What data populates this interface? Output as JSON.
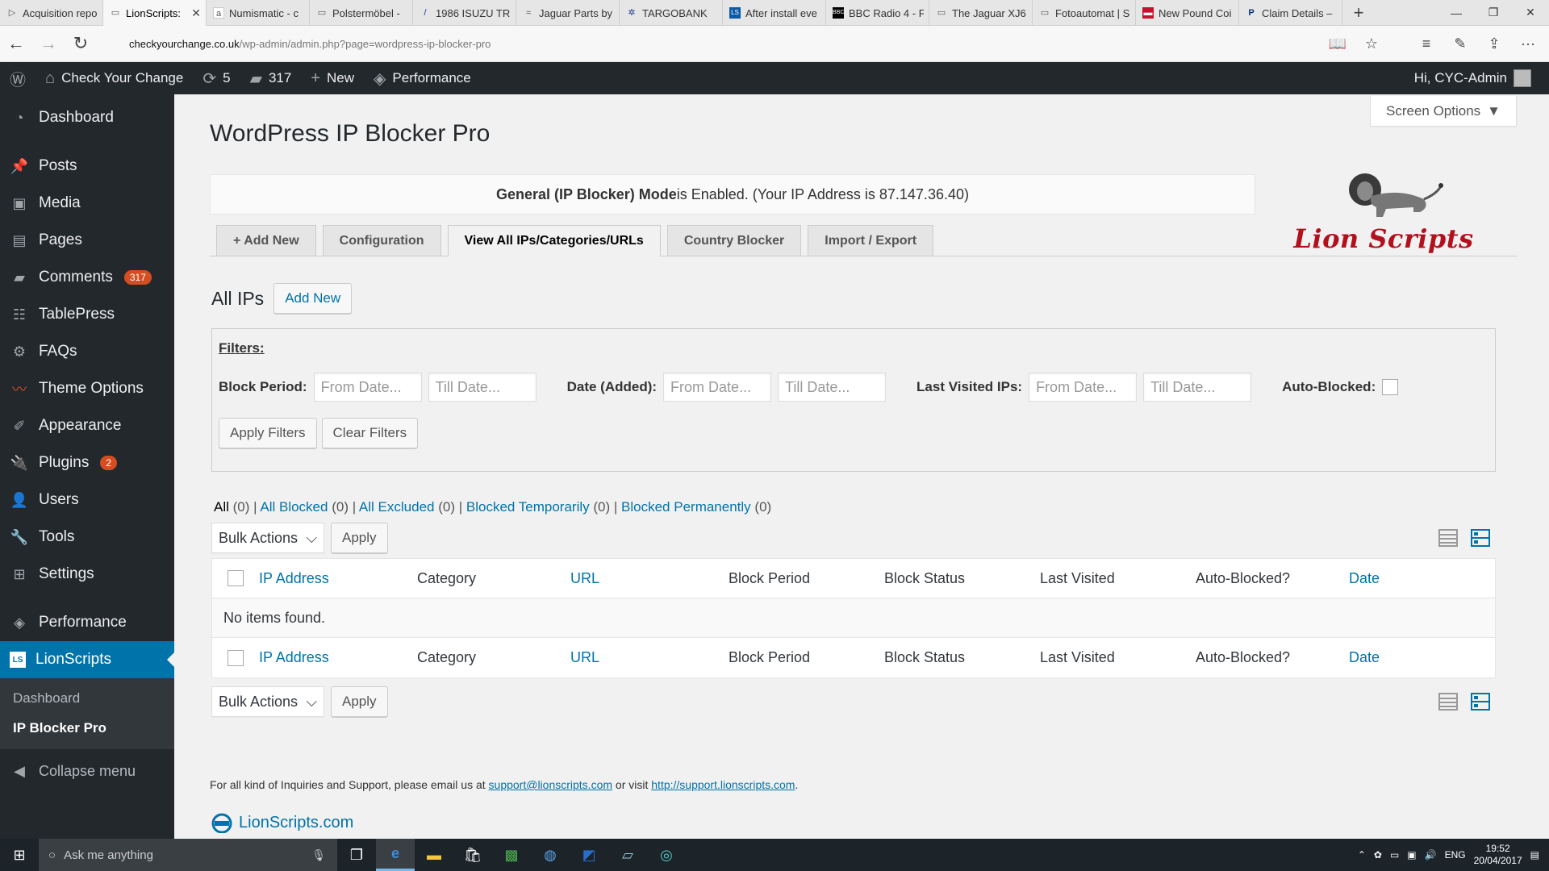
{
  "browser": {
    "tabs": [
      {
        "label": "Acquisition repo",
        "icon": "play-icon"
      },
      {
        "label": "LionScripts:",
        "icon": "document-icon",
        "active": true
      },
      {
        "label": "Numismatic - c",
        "icon": "amazon-icon"
      },
      {
        "label": "Polstermöbel -",
        "icon": "document-icon"
      },
      {
        "label": "1986 ISUZU TR",
        "icon": "car-icon"
      },
      {
        "label": "Jaguar Parts by",
        "icon": "jaguar-icon"
      },
      {
        "label": "TARGOBANK",
        "icon": "star-icon"
      },
      {
        "label": "After install eve",
        "icon": "ls-icon"
      },
      {
        "label": "BBC Radio 4 - F",
        "icon": "bbc-icon"
      },
      {
        "label": "The Jaguar XJ6",
        "icon": "document-icon"
      },
      {
        "label": "Fotoautomat | S",
        "icon": "document-icon"
      },
      {
        "label": "New Pound Coi",
        "icon": "flag-icon"
      },
      {
        "label": "Claim Details –",
        "icon": "paypal-icon"
      }
    ],
    "url_domain": "checkyourchange.co.uk",
    "url_path": "/wp-admin/admin.php?page=wordpress-ip-blocker-pro"
  },
  "adminbar": {
    "site": "Check Your Change",
    "updates": "5",
    "comments": "317",
    "new": "New",
    "performance": "Performance",
    "greeting": "Hi, CYC-Admin"
  },
  "sidebar": {
    "items": [
      {
        "label": "Dashboard",
        "icon": "dashboard-icon"
      },
      {
        "label": "Posts",
        "icon": "pin-icon"
      },
      {
        "label": "Media",
        "icon": "media-icon"
      },
      {
        "label": "Pages",
        "icon": "pages-icon"
      },
      {
        "label": "Comments",
        "icon": "comment-icon",
        "badge": "317"
      },
      {
        "label": "TablePress",
        "icon": "table-icon"
      },
      {
        "label": "FAQs",
        "icon": "gear-icon"
      },
      {
        "label": "Theme Options",
        "icon": "theme-icon"
      },
      {
        "label": "Appearance",
        "icon": "brush-icon"
      },
      {
        "label": "Plugins",
        "icon": "plugin-icon",
        "badge": "2"
      },
      {
        "label": "Users",
        "icon": "user-icon"
      },
      {
        "label": "Tools",
        "icon": "wrench-icon"
      },
      {
        "label": "Settings",
        "icon": "settings-icon"
      },
      {
        "label": "Performance",
        "icon": "performance-icon"
      },
      {
        "label": "LionScripts",
        "icon": "ls-icon"
      }
    ],
    "submenu": [
      "Dashboard",
      "IP Blocker Pro"
    ],
    "collapse": "Collapse menu"
  },
  "main": {
    "screen_options": "Screen Options",
    "title": "WordPress IP Blocker Pro",
    "notice": {
      "bold": "General (IP Blocker) Mode",
      "rest": " is Enabled. (Your IP Address is 87.147.36.40)"
    },
    "logo_text": "Lion Scripts",
    "tabs": [
      "+ Add New",
      "Configuration",
      "View All IPs/Categories/URLs",
      "Country Blocker",
      "Import / Export"
    ],
    "section_title": "All IPs",
    "add_new": "Add New",
    "filters": {
      "title": "Filters:",
      "block_period": "Block Period:",
      "date_added": "Date (Added):",
      "last_visited": "Last Visited IPs:",
      "from_ph": "From Date...",
      "till_ph": "Till Date...",
      "auto_blocked": "Auto-Blocked:",
      "apply": "Apply Filters",
      "clear": "Clear Filters"
    },
    "views": [
      {
        "label": "All",
        "count": "(0)"
      },
      {
        "label": "All Blocked",
        "count": "(0)"
      },
      {
        "label": "All Excluded",
        "count": "(0)"
      },
      {
        "label": "Blocked Temporarily",
        "count": "(0)"
      },
      {
        "label": "Blocked Permanently",
        "count": "(0)"
      }
    ],
    "bulk_actions": "Bulk Actions",
    "apply": "Apply",
    "columns": [
      "IP Address",
      "Category",
      "URL",
      "Block Period",
      "Block Status",
      "Last Visited",
      "Auto-Blocked?",
      "Date"
    ],
    "empty": "No items found.",
    "footer": {
      "prefix": "For all kind of Inquiries and Support, please email us at ",
      "email": "support@lionscripts.com",
      "mid": " or visit ",
      "link": "http://support.lionscripts.com",
      "end": "."
    },
    "footer_logo": "LionScripts.com"
  },
  "taskbar": {
    "search": "Ask me anything",
    "lang": "ENG",
    "time": "19:52",
    "date": "20/04/2017"
  }
}
